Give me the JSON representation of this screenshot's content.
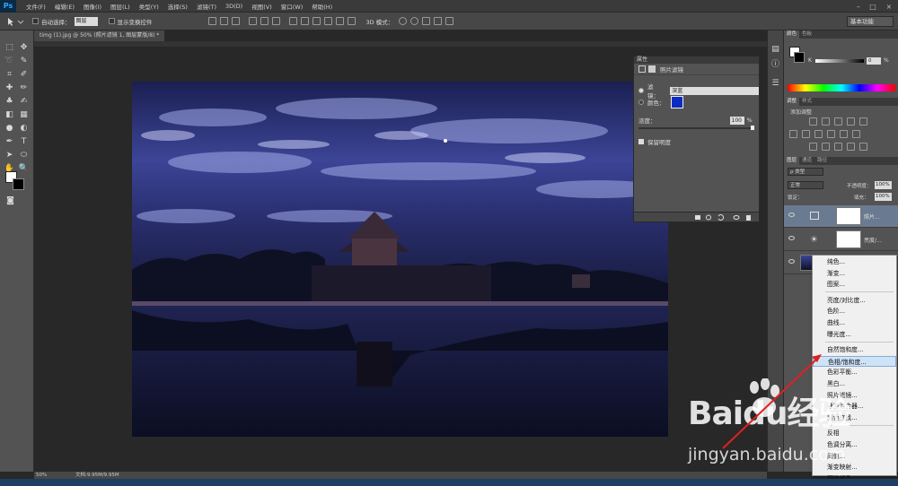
{
  "menubar": {
    "logo": "Ps",
    "items": [
      "文件(F)",
      "编辑(E)",
      "图像(I)",
      "图层(L)",
      "类型(Y)",
      "选择(S)",
      "滤镜(T)",
      "3D(D)",
      "视图(V)",
      "窗口(W)",
      "帮助(H)"
    ],
    "min": "–",
    "max": "□",
    "close": "×"
  },
  "options": {
    "auto_select": "自动选择：",
    "auto_select_value": "图层",
    "show_transform": "显示变换控件",
    "mode_3d": "3D 模式："
  },
  "workspace": "基本功能",
  "document": {
    "tab": "timg (1).jpg @ 50% (照片滤镜 1, 图层蒙版/8) *"
  },
  "properties_panel": {
    "title": "属性",
    "header": "照片滤镜",
    "filter_label": "滤镜：",
    "filter_value": "深蓝",
    "color_label": "颜色：",
    "density_label": "浓度：",
    "density_value": "100",
    "density_unit": "%",
    "preserve_label": "保留明度",
    "color_hex": "#0b2cc4"
  },
  "color_panel": {
    "tabs": [
      "颜色",
      "色板"
    ],
    "k_label": "K",
    "k_value": "0",
    "unit": "%"
  },
  "adjust_panel": {
    "tabs": [
      "调整",
      "样式"
    ],
    "title": "添加调整"
  },
  "layers_panel": {
    "tabs": [
      "图层",
      "通道",
      "路径"
    ],
    "kind_filter": "ρ 类型",
    "blend_mode": "正常",
    "opacity_label": "不透明度：",
    "opacity_value": "100%",
    "lock_label": "锁定：",
    "fill_label": "填充：",
    "fill_value": "100%",
    "layers": [
      {
        "name": "照片..."
      },
      {
        "name": "亮度/..."
      }
    ]
  },
  "context_menu": {
    "groups": [
      [
        "纯色...",
        "渐变...",
        "图案..."
      ],
      [
        "亮度/对比度...",
        "色阶...",
        "曲线...",
        "曝光度..."
      ],
      [
        "自然饱和度...",
        "色相/饱和度...",
        "色彩平衡...",
        "黑白...",
        "照片滤镜...",
        "通道混合器...",
        "颜色查找..."
      ],
      [
        "反相",
        "色调分离...",
        "阈值...",
        "渐变映射...",
        "可选颜色..."
      ]
    ],
    "highlighted": "色相/饱和度..."
  },
  "status": {
    "zoom": "50%",
    "doc": "文档:9.95M/9.95M"
  },
  "watermark": {
    "brand": "Baidu经验",
    "url": "jingyan.baidu.com"
  }
}
